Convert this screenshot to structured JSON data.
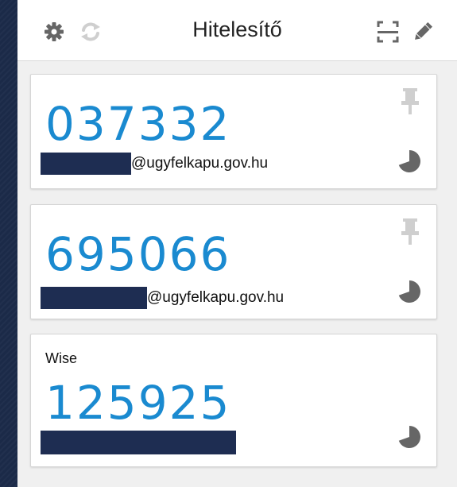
{
  "header": {
    "title": "Hitelesítő",
    "left_icons": [
      "gear-icon",
      "sync-icon"
    ],
    "right_icons": [
      "qr-scan-icon",
      "pencil-icon"
    ]
  },
  "accounts": [
    {
      "issuer": "",
      "code": "037332",
      "account_suffix": "@ugyfelkapu.gov.hu",
      "pinned_icon": "pin-icon"
    },
    {
      "issuer": "",
      "code": "695066",
      "account_suffix": "@ugyfelkapu.gov.hu",
      "pinned_icon": "pin-icon"
    },
    {
      "issuer": "Wise",
      "code": "125925",
      "account_suffix": ""
    }
  ],
  "colors": {
    "code": "#1a8ad0",
    "icons": "#666666",
    "redaction": "#1e2d52",
    "background": "#1c2b4a"
  }
}
